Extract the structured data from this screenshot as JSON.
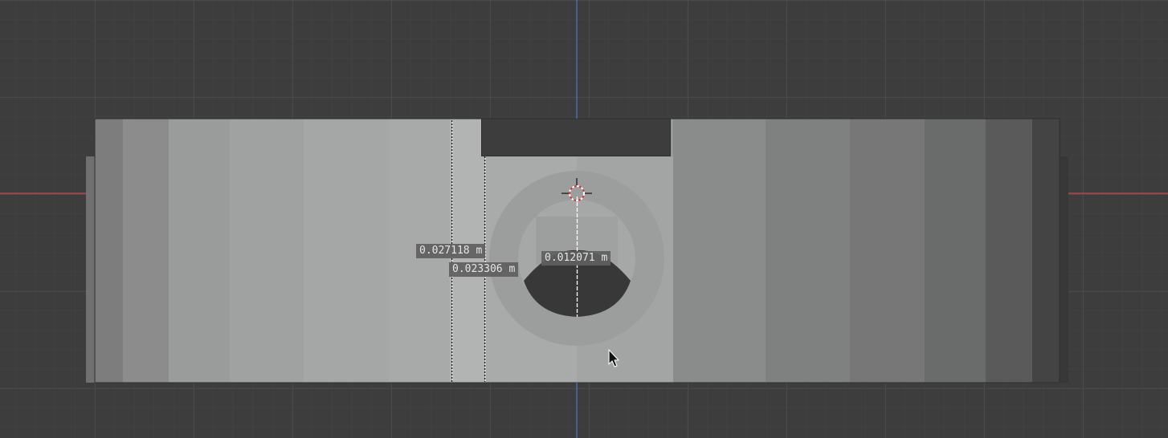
{
  "viewport": {
    "background_color": "#3d3d3d",
    "grid_color": "#4a4a4a",
    "x_axis_color": "#d04a4a",
    "y_axis_color": "#4a78c8",
    "model_shades": [
      "#7c7d7c",
      "#8b8c8b",
      "#9a9c9b",
      "#a0a2a1",
      "#a5a7a6",
      "#a8aaa9",
      "#b2b3b3",
      "#a6a8a7",
      "#989a99",
      "#8a8b8b",
      "#7f8080",
      "#767776",
      "#6a6b6b",
      "#5a5a5a",
      "#444444",
      "#3c3b3b"
    ]
  },
  "measurements": {
    "outer_width": "0.027118 m",
    "inner_width": "0.023306 m",
    "hole_depth": "0.012071 m"
  },
  "tools": {
    "cursor_3d": "3d-cursor",
    "mouse_pointer": "mouse-pointer-icon"
  }
}
